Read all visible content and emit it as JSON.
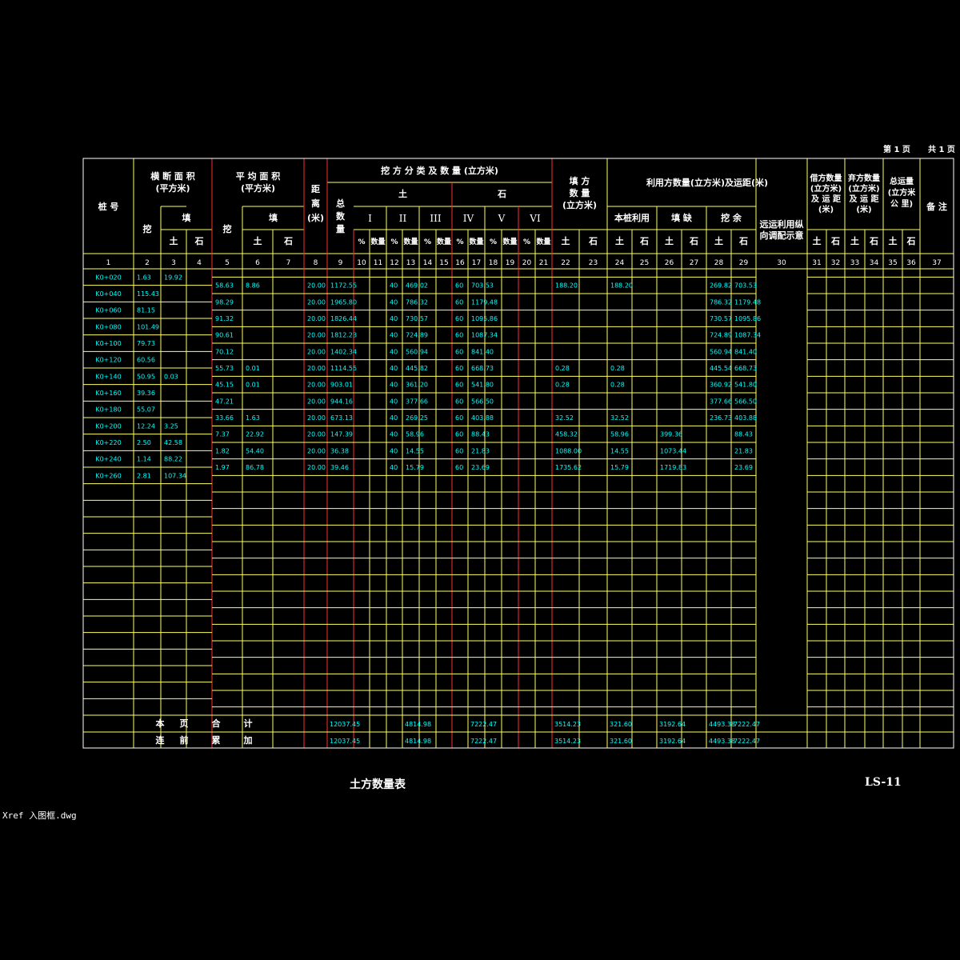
{
  "page_info": {
    "page_label": "第 1 页",
    "total_label": "共 1 页"
  },
  "title": "土方数量表",
  "drawing_no": "LS-11",
  "xref_note": "Xref 入图框.dwg",
  "colors": {
    "background": "#000000",
    "outer_border": "#ffffff",
    "grid": "#ffff66",
    "divider": "#ff2d2d",
    "data": "#00ffff",
    "text": "#ffffff"
  },
  "headers": {
    "station": "桩 号",
    "section_area": "横 断 面 积",
    "section_area_unit": "(平方米)",
    "avg_area": "平 均 面 积",
    "avg_area_unit": "(平方米)",
    "distance": [
      "距",
      "离",
      "(米)"
    ],
    "cut_class": "挖 方 分 类 及 数 量 (立方米)",
    "total_qty": [
      "总",
      "数",
      "量"
    ],
    "soil": "土",
    "rock": "石",
    "grades": [
      "I",
      "II",
      "III",
      "IV",
      "V",
      "VI"
    ],
    "pct": "%",
    "qty": "数量",
    "fill_qty": [
      "填 方",
      "数 量",
      "(立方米)"
    ],
    "reuse": "利用方数量(立方米)及运距(米)",
    "reuse_sub": [
      "本桩利用",
      "填 缺",
      "挖 余"
    ],
    "haul": [
      "远运利用纵",
      "向调配示意"
    ],
    "borrow": [
      "借方数量",
      "(立方米)",
      "及 运 距",
      "(米)"
    ],
    "waste": [
      "弃方数量",
      "(立方米)",
      "及 运 距",
      "(米)"
    ],
    "total_haul": [
      "总运量",
      "(立方米",
      "公 里)"
    ],
    "remark": "备 注",
    "cut": "挖",
    "fill": "填",
    "earth": "土",
    "stone": "石"
  },
  "column_numbers": [
    "1",
    "2",
    "3",
    "4",
    "5",
    "6",
    "7",
    "8",
    "9",
    "10",
    "11",
    "12",
    "13",
    "14",
    "15",
    "16",
    "17",
    "18",
    "19",
    "20",
    "21",
    "22",
    "23",
    "24",
    "25",
    "26",
    "27",
    "28",
    "29",
    "30",
    "31",
    "32",
    "33",
    "34",
    "35",
    "36",
    "37"
  ],
  "stations": [
    {
      "stake": "K0+020",
      "cut": "1.63",
      "fill": "19.92"
    },
    {
      "stake": "K0+040",
      "cut": "115.43",
      "fill": ""
    },
    {
      "stake": "K0+060",
      "cut": "81.15",
      "fill": ""
    },
    {
      "stake": "K0+080",
      "cut": "101.49",
      "fill": ""
    },
    {
      "stake": "K0+100",
      "cut": "79.73",
      "fill": ""
    },
    {
      "stake": "K0+120",
      "cut": "60.56",
      "fill": ""
    },
    {
      "stake": "K0+140",
      "cut": "50.95",
      "fill": "0.03"
    },
    {
      "stake": "K0+160",
      "cut": "39.36",
      "fill": ""
    },
    {
      "stake": "K0+180",
      "cut": "55.07",
      "fill": ""
    },
    {
      "stake": "K0+200",
      "cut": "12.24",
      "fill": "3.25"
    },
    {
      "stake": "K0+220",
      "cut": "2.50",
      "fill": "42.58"
    },
    {
      "stake": "K0+240",
      "cut": "1.14",
      "fill": "88.22"
    },
    {
      "stake": "K0+260",
      "cut": "2.81",
      "fill": "107.34"
    }
  ],
  "segments": [
    {
      "avg_cut": "58.63",
      "avg_fill": "8.86",
      "dist": "20.00",
      "total": "1172.55",
      "p2": "40",
      "q2": "469.02",
      "p4": "60",
      "q4": "703.53",
      "fill_soil": "188.20",
      "own_soil": "188.20",
      "gap_soil": "",
      "rem_soil": "269.82",
      "rem_rock": "703.53"
    },
    {
      "avg_cut": "98.29",
      "avg_fill": "",
      "dist": "20.00",
      "total": "1965.80",
      "p2": "40",
      "q2": "786.32",
      "p4": "60",
      "q4": "1179.48",
      "fill_soil": "",
      "own_soil": "",
      "gap_soil": "",
      "rem_soil": "786.32",
      "rem_rock": "1179.48"
    },
    {
      "avg_cut": "91.32",
      "avg_fill": "",
      "dist": "20.00",
      "total": "1826.44",
      "p2": "40",
      "q2": "730.57",
      "p4": "60",
      "q4": "1095.86",
      "fill_soil": "",
      "own_soil": "",
      "gap_soil": "",
      "rem_soil": "730.57",
      "rem_rock": "1095.86"
    },
    {
      "avg_cut": "90.61",
      "avg_fill": "",
      "dist": "20.00",
      "total": "1812.23",
      "p2": "40",
      "q2": "724.89",
      "p4": "60",
      "q4": "1087.34",
      "fill_soil": "",
      "own_soil": "",
      "gap_soil": "",
      "rem_soil": "724.89",
      "rem_rock": "1087.34"
    },
    {
      "avg_cut": "70.12",
      "avg_fill": "",
      "dist": "20.00",
      "total": "1402.34",
      "p2": "40",
      "q2": "560.94",
      "p4": "60",
      "q4": "841.40",
      "fill_soil": "",
      "own_soil": "",
      "gap_soil": "",
      "rem_soil": "560.94",
      "rem_rock": "841.40"
    },
    {
      "avg_cut": "55.73",
      "avg_fill": "0.01",
      "dist": "20.00",
      "total": "1114.55",
      "p2": "40",
      "q2": "445.82",
      "p4": "60",
      "q4": "668.73",
      "fill_soil": "0.28",
      "own_soil": "0.28",
      "gap_soil": "",
      "rem_soil": "445.54",
      "rem_rock": "668.73"
    },
    {
      "avg_cut": "45.15",
      "avg_fill": "0.01",
      "dist": "20.00",
      "total": "903.01",
      "p2": "40",
      "q2": "361.20",
      "p4": "60",
      "q4": "541.80",
      "fill_soil": "0.28",
      "own_soil": "0.28",
      "gap_soil": "",
      "rem_soil": "360.92",
      "rem_rock": "541.80"
    },
    {
      "avg_cut": "47.21",
      "avg_fill": "",
      "dist": "20.00",
      "total": "944.16",
      "p2": "40",
      "q2": "377.66",
      "p4": "60",
      "q4": "566.50",
      "fill_soil": "",
      "own_soil": "",
      "gap_soil": "",
      "rem_soil": "377.66",
      "rem_rock": "566.50"
    },
    {
      "avg_cut": "33.66",
      "avg_fill": "1.63",
      "dist": "20.00",
      "total": "673.13",
      "p2": "40",
      "q2": "269.25",
      "p4": "60",
      "q4": "403.88",
      "fill_soil": "32.52",
      "own_soil": "32.52",
      "gap_soil": "",
      "rem_soil": "236.73",
      "rem_rock": "403.88"
    },
    {
      "avg_cut": "7.37",
      "avg_fill": "22.92",
      "dist": "20.00",
      "total": "147.39",
      "p2": "40",
      "q2": "58.96",
      "p4": "60",
      "q4": "88.43",
      "fill_soil": "458.32",
      "own_soil": "58.96",
      "gap_soil": "399.36",
      "rem_soil": "",
      "rem_rock": "88.43"
    },
    {
      "avg_cut": "1.82",
      "avg_fill": "54.40",
      "dist": "20.00",
      "total": "36.38",
      "p2": "40",
      "q2": "14.55",
      "p4": "60",
      "q4": "21.83",
      "fill_soil": "1088.00",
      "own_soil": "14.55",
      "gap_soil": "1073.44",
      "rem_soil": "",
      "rem_rock": "21.83"
    },
    {
      "avg_cut": "1.97",
      "avg_fill": "86.78",
      "dist": "20.00",
      "total": "39.46",
      "p2": "40",
      "q2": "15.79",
      "p4": "60",
      "q4": "23.69",
      "fill_soil": "1735.62",
      "own_soil": "15.79",
      "gap_soil": "1719.83",
      "rem_soil": "",
      "rem_rock": "23.69"
    }
  ],
  "footer": {
    "page_total_label": [
      "本",
      "页",
      "合",
      "计"
    ],
    "cumulative_label": [
      "连",
      "前",
      "累",
      "加"
    ],
    "page_total": {
      "total": "12037.45",
      "q2": "4814.98",
      "q4": "7222.47",
      "fill_soil": "3514.23",
      "own_soil": "321.60",
      "gap_soil": "3192.64",
      "rem_soil": "4493.38",
      "rem_rock": "7222.47"
    },
    "cumulative": {
      "total": "12037.45",
      "q2": "4814.98",
      "q4": "7222.47",
      "fill_soil": "3514.23",
      "own_soil": "321.60",
      "gap_soil": "3192.64",
      "rem_soil": "4493.38",
      "rem_rock": "7222.47"
    }
  }
}
